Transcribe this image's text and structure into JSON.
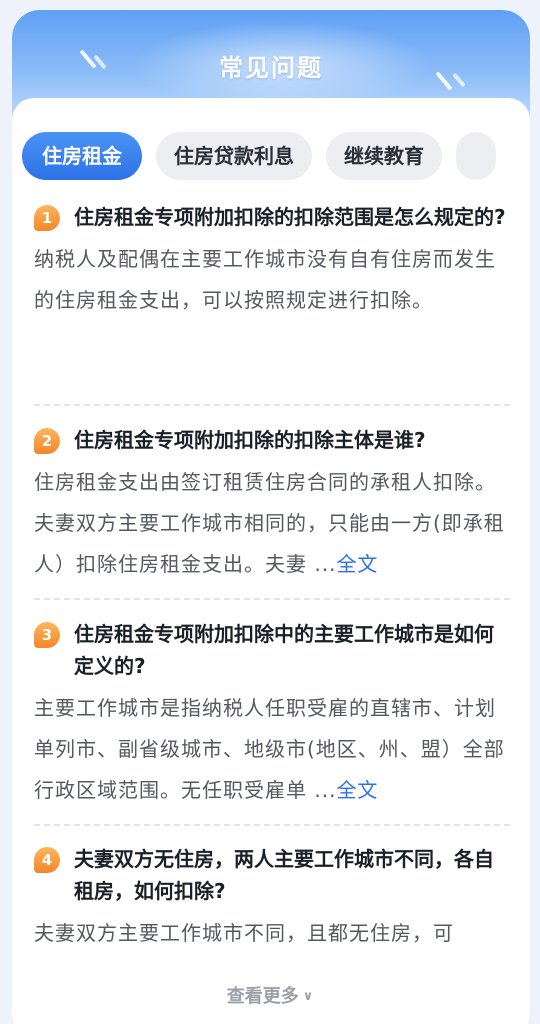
{
  "header": {
    "title": "常见问题"
  },
  "tabs": [
    {
      "label": "住房租金"
    },
    {
      "label": "住房贷款利息"
    },
    {
      "label": "继续教育"
    },
    {
      "label": ""
    }
  ],
  "faqs": [
    {
      "num": "1",
      "question": "住房租金专项附加扣除的扣除范围是怎么规定的?",
      "answer": "纳税人及配偶在主要工作城市没有自有住房而发生的住房租金支出，可以按照规定进行扣除。",
      "more": ""
    },
    {
      "num": "2",
      "question": "住房租金专项附加扣除的扣除主体是谁?",
      "answer": "住房租金支出由签订租赁住房合同的承租人扣除。夫妻双方主要工作城市相同的，只能由一方(即承租人）扣除住房租金支出。夫妻 ...",
      "more": "全文"
    },
    {
      "num": "3",
      "question": "住房租金专项附加扣除中的主要工作城市是如何定义的?",
      "answer": "主要工作城市是指纳税人任职受雇的直辖市、计划单列市、副省级城市、地级市(地区、州、盟）全部行政区域范围。无任职受雇单 ...",
      "more": "全文"
    },
    {
      "num": "4",
      "question": "夫妻双方无住房，两人主要工作城市不同，各自租房，如何扣除?",
      "answer": "夫妻双方主要工作城市不同，且都无住房，可",
      "more": ""
    }
  ],
  "footer": {
    "more_label": "查看更多"
  },
  "colors": {
    "accent": "#2c72e6",
    "badge": "#f5862a"
  }
}
